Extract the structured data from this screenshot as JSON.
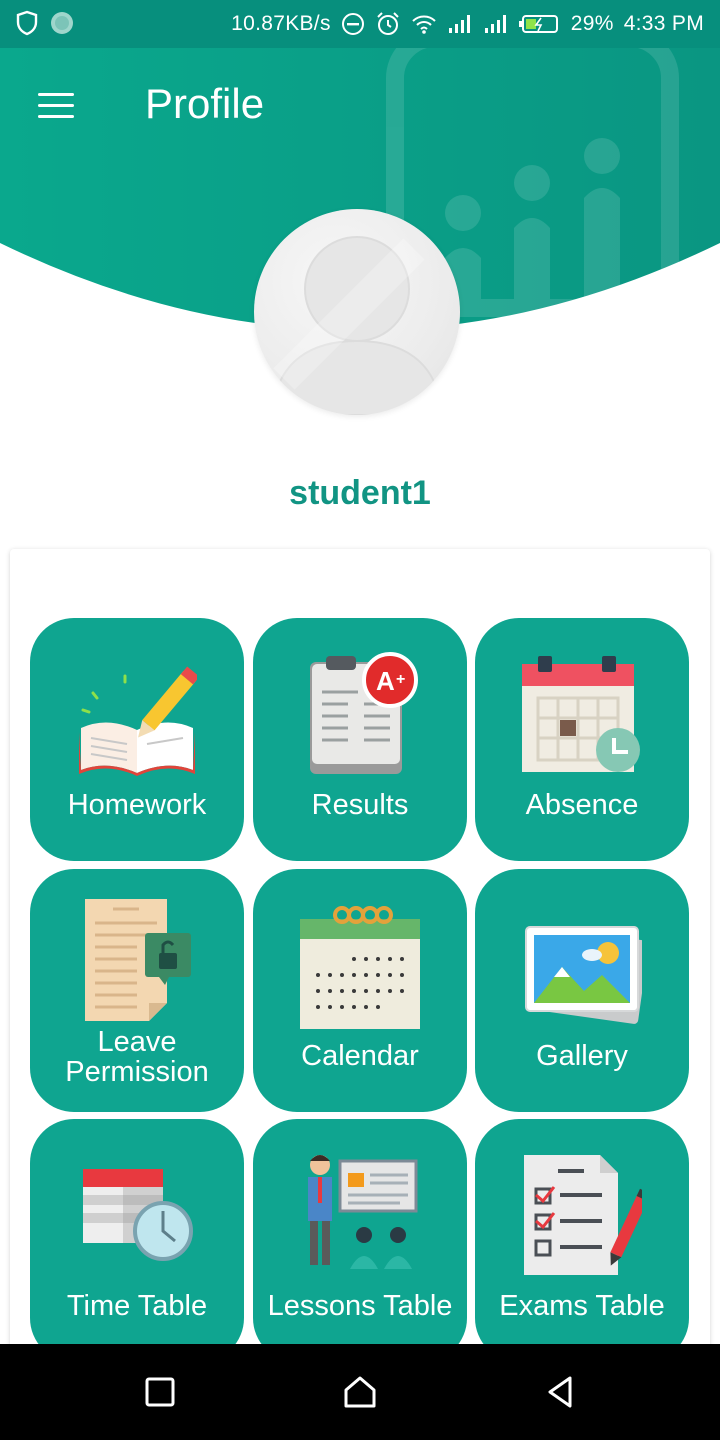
{
  "status_bar": {
    "speed": "10.87KB/s",
    "battery": "29%",
    "time": "4:33 PM"
  },
  "header": {
    "title": "Profile",
    "color": "#0a9b86"
  },
  "profile": {
    "username": "student1"
  },
  "menu": {
    "tiles": [
      {
        "label": "Homework",
        "icon": "homework-icon"
      },
      {
        "label": "Results",
        "icon": "results-icon"
      },
      {
        "label": "Absence",
        "icon": "absence-icon"
      },
      {
        "label_line1": "Leave",
        "label_line2": "Permission",
        "icon": "leave-permission-icon"
      },
      {
        "label": "Calendar",
        "icon": "calendar-icon"
      },
      {
        "label": "Gallery",
        "icon": "gallery-icon"
      },
      {
        "label": "Time Table",
        "icon": "time-table-icon"
      },
      {
        "label": "Lessons Table",
        "icon": "lessons-table-icon"
      },
      {
        "label": "Exams Table",
        "icon": "exams-table-icon"
      }
    ]
  },
  "nav_bar": {
    "buttons": [
      "recents-icon",
      "home-icon",
      "back-icon"
    ]
  }
}
